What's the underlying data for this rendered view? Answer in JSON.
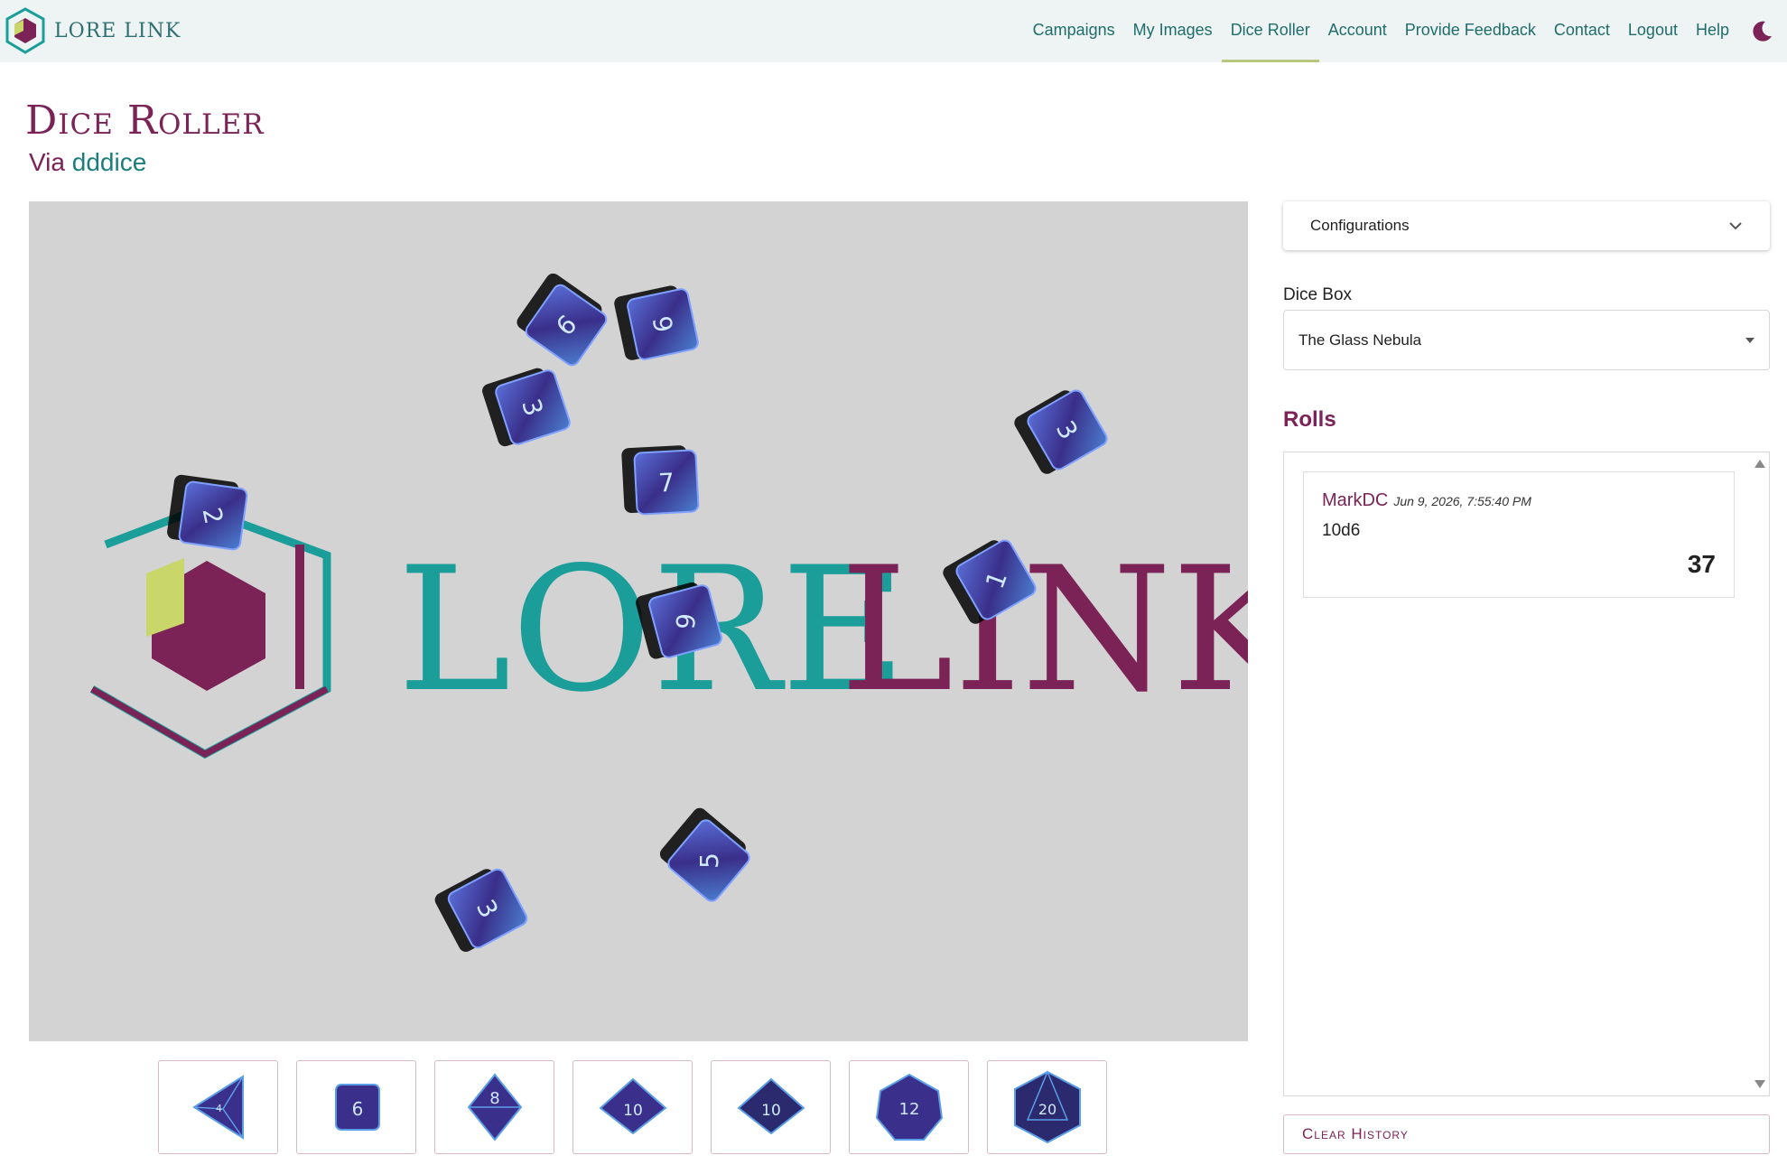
{
  "brand": {
    "name": "LORE LINK"
  },
  "nav": {
    "items": [
      {
        "label": "Campaigns"
      },
      {
        "label": "My Images"
      },
      {
        "label": "Dice Roller",
        "active": true
      },
      {
        "label": "Account"
      },
      {
        "label": "Provide Feedback"
      },
      {
        "label": "Contact"
      },
      {
        "label": "Logout"
      },
      {
        "label": "Help"
      }
    ],
    "theme_icon": "moon-icon"
  },
  "page": {
    "title": "Dice Roller",
    "subtitle_prefix": "Via",
    "subtitle_link": "dddice"
  },
  "stage": {
    "watermark": {
      "word1": "LORE",
      "word2": "LINK"
    },
    "dice": [
      {
        "value": "6"
      },
      {
        "value": "9"
      },
      {
        "value": "3"
      },
      {
        "value": "7"
      },
      {
        "value": "2"
      },
      {
        "value": "6"
      },
      {
        "value": "1"
      },
      {
        "value": "3"
      },
      {
        "value": "5"
      },
      {
        "value": "3"
      }
    ]
  },
  "die_buttons": [
    {
      "face": "4",
      "icon": "d4-icon"
    },
    {
      "face": "6",
      "icon": "d6-icon"
    },
    {
      "face": "8",
      "icon": "d8-icon"
    },
    {
      "face": "10",
      "icon": "d10-icon"
    },
    {
      "face": "10",
      "icon": "d100-icon"
    },
    {
      "face": "12",
      "icon": "d12-icon"
    },
    {
      "face": "20",
      "icon": "d20-icon"
    }
  ],
  "sidebar": {
    "config_label": "Configurations",
    "dice_box_label": "Dice Box",
    "dice_box_value": "The Glass Nebula",
    "rolls_title": "Rolls",
    "clear_label": "Clear History"
  },
  "rolls": [
    {
      "user": "MarkDC",
      "time": "Jun 9, 2026, 7:55:40 PM",
      "formula": "10d6",
      "total": "37"
    }
  ],
  "colors": {
    "brand_purple": "#7b2256",
    "brand_teal": "#1b9e9a",
    "brand_lime": "#c9d66a",
    "stage_bg": "#d3d3d3",
    "dice_blue": "#3d4fb8"
  }
}
